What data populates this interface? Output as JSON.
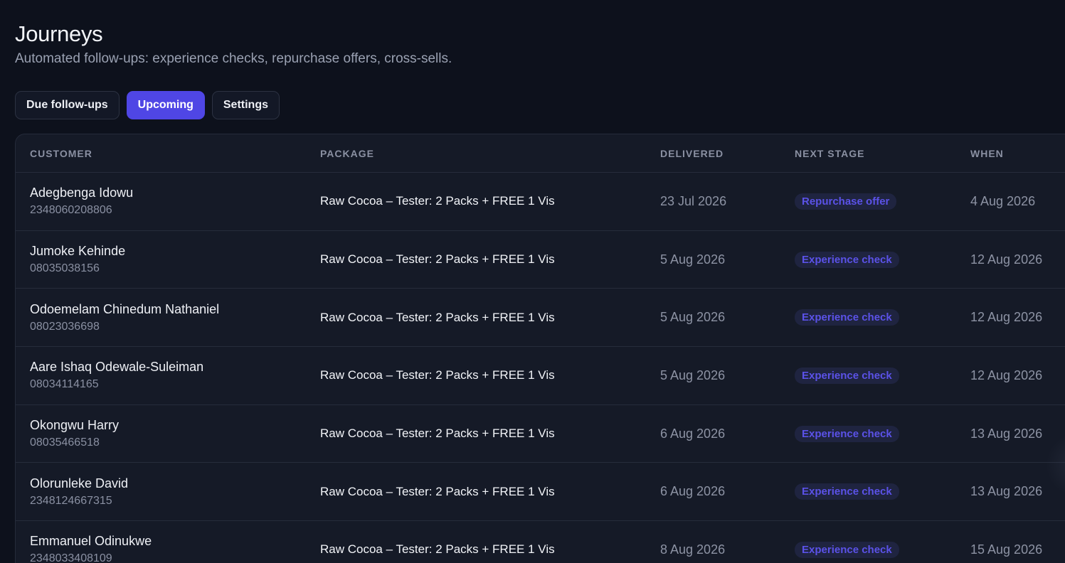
{
  "header": {
    "title": "Journeys",
    "subtitle": "Automated follow-ups: experience checks, repurchase offers, cross-sells."
  },
  "tabs": [
    {
      "label": "Due follow-ups",
      "active": false
    },
    {
      "label": "Upcoming",
      "active": true
    },
    {
      "label": "Settings",
      "active": false
    }
  ],
  "table": {
    "columns": [
      "CUSTOMER",
      "PACKAGE",
      "DELIVERED",
      "NEXT STAGE",
      "WHEN"
    ],
    "rows": [
      {
        "name": "Adegbenga Idowu",
        "phone": "2348060208806",
        "package": "Raw Cocoa – Tester: 2 Packs + FREE 1 Vis",
        "delivered": "23 Jul 2026",
        "stage": "Repurchase offer",
        "when": "4 Aug 2026"
      },
      {
        "name": "Jumoke Kehinde",
        "phone": "08035038156",
        "package": "Raw Cocoa – Tester: 2 Packs + FREE 1 Vis",
        "delivered": "5 Aug 2026",
        "stage": "Experience check",
        "when": "12 Aug 2026"
      },
      {
        "name": "Odoemelam Chinedum Nathaniel",
        "phone": "08023036698",
        "package": "Raw Cocoa – Tester: 2 Packs + FREE 1 Vis",
        "delivered": "5 Aug 2026",
        "stage": "Experience check",
        "when": "12 Aug 2026"
      },
      {
        "name": "Aare Ishaq Odewale-Suleiman",
        "phone": "08034114165",
        "package": "Raw Cocoa – Tester: 2 Packs + FREE 1 Vis",
        "delivered": "5 Aug 2026",
        "stage": "Experience check",
        "when": "12 Aug 2026"
      },
      {
        "name": "Okongwu Harry",
        "phone": "08035466518",
        "package": "Raw Cocoa – Tester: 2 Packs + FREE 1 Vis",
        "delivered": "6 Aug 2026",
        "stage": "Experience check",
        "when": "13 Aug 2026"
      },
      {
        "name": "Olorunleke David",
        "phone": "2348124667315",
        "package": "Raw Cocoa – Tester: 2 Packs + FREE 1 Vis",
        "delivered": "6 Aug 2026",
        "stage": "Experience check",
        "when": "13 Aug 2026"
      },
      {
        "name": "Emmanuel Odinukwe",
        "phone": "2348033408109",
        "package": "Raw Cocoa – Tester: 2 Packs + FREE 1 Vis",
        "delivered": "8 Aug 2026",
        "stage": "Experience check",
        "when": "15 Aug 2026"
      }
    ]
  },
  "colors": {
    "background": "#0d111c",
    "accent": "#4f46e5",
    "badge_text": "#5b52e8"
  }
}
